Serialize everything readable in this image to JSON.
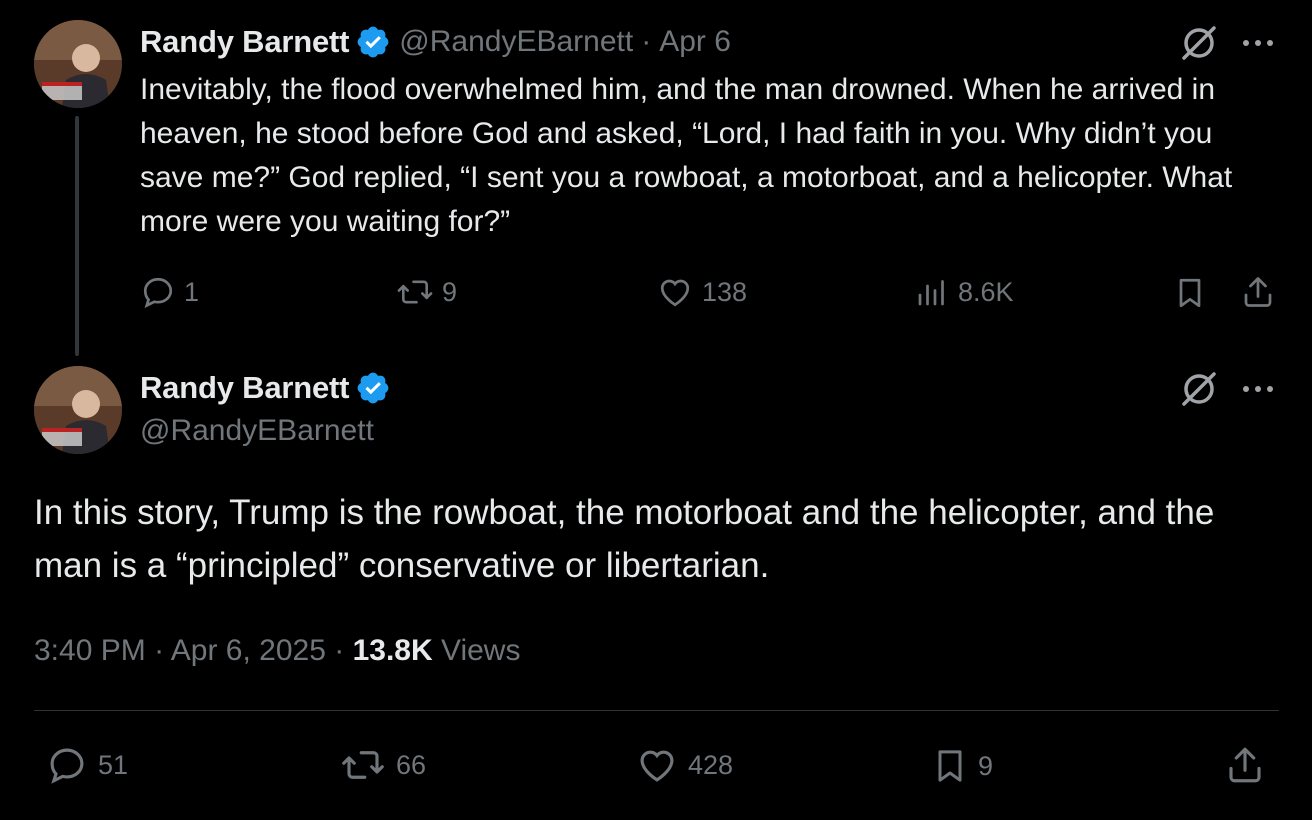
{
  "thread_tweet": {
    "author_name": "Randy Barnett",
    "handle": "@RandyEBarnett",
    "separator": "·",
    "date": "Apr 6",
    "text": "Inevitably, the flood overwhelmed him, and the man drowned. When he arrived in heaven, he stood before God and asked, “Lord, I had faith in you. Why didn’t you save me?” God replied, “I sent you a rowboat, a motorboat, and a helicopter. What more were you waiting for?”",
    "replies": "1",
    "reposts": "9",
    "likes": "138",
    "views": "8.6K",
    "icons": [
      "grok-icon",
      "more-icon",
      "reply-icon",
      "repost-icon",
      "like-icon",
      "views-icon",
      "bookmark-icon",
      "share-icon"
    ]
  },
  "main_tweet": {
    "author_name": "Randy Barnett",
    "handle": "@RandyEBarnett",
    "text": "In this story, Trump is the rowboat, the motorboat and the helicopter, and the man is a “principled” conservative or libertarian.",
    "time": "3:40 PM",
    "date": "Apr 6, 2025",
    "separator": "·",
    "views_count": "13.8K",
    "views_label": "Views",
    "replies": "51",
    "reposts": "66",
    "likes": "428",
    "bookmarks": "9"
  },
  "colors": {
    "background": "#000000",
    "text": "#e7e9ea",
    "muted": "#71767b",
    "verified": "#1d9bf0",
    "divider": "#2f3336"
  }
}
